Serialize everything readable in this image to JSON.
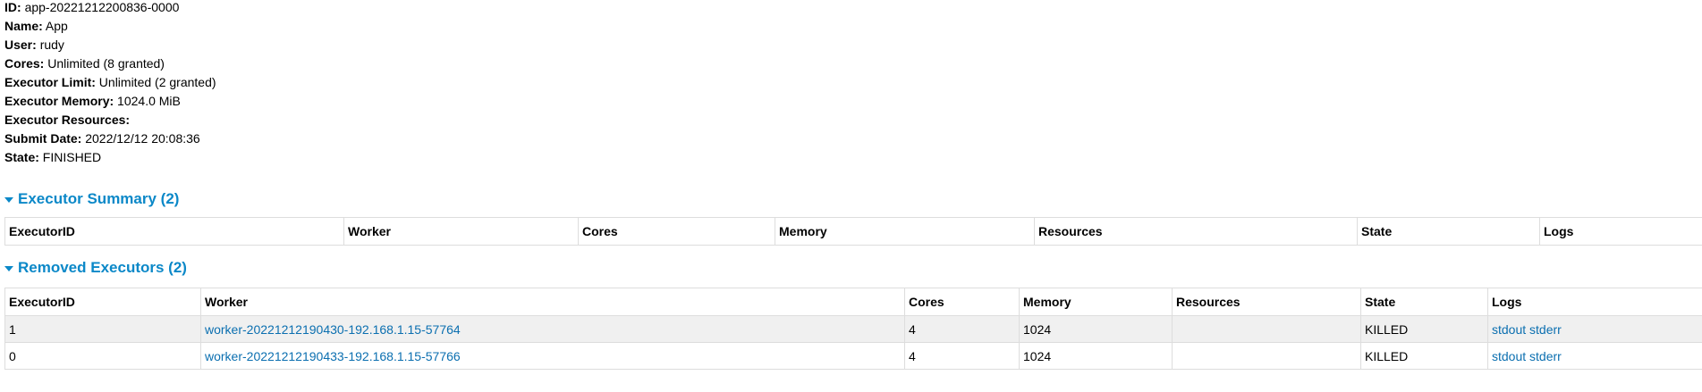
{
  "app_info": {
    "id_label": "ID:",
    "id_value": "app-20221212200836-0000",
    "name_label": "Name:",
    "name_value": "App",
    "user_label": "User:",
    "user_value": "rudy",
    "cores_label": "Cores:",
    "cores_value": "Unlimited (8 granted)",
    "exec_limit_label": "Executor Limit:",
    "exec_limit_value": "Unlimited (2 granted)",
    "exec_memory_label": "Executor Memory:",
    "exec_memory_value": "1024.0 MiB",
    "exec_resources_label": "Executor Resources:",
    "exec_resources_value": "",
    "submit_date_label": "Submit Date:",
    "submit_date_value": "2022/12/12 20:08:36",
    "state_label": "State:",
    "state_value": "FINISHED"
  },
  "executor_summary": {
    "title": "Executor Summary (2)",
    "headers": [
      "ExecutorID",
      "Worker",
      "Cores",
      "Memory",
      "Resources",
      "State",
      "Logs"
    ]
  },
  "removed_executors": {
    "title": "Removed Executors (2)",
    "headers": [
      "ExecutorID",
      "Worker",
      "Cores",
      "Memory",
      "Resources",
      "State",
      "Logs"
    ],
    "rows": [
      {
        "id": "1",
        "worker": "worker-20221212190430-192.168.1.15-57764",
        "cores": "4",
        "memory": "1024",
        "resources": "",
        "state": "KILLED",
        "stdout": "stdout",
        "stderr": "stderr"
      },
      {
        "id": "0",
        "worker": "worker-20221212190433-192.168.1.15-57766",
        "cores": "4",
        "memory": "1024",
        "resources": "",
        "state": "KILLED",
        "stdout": "stdout",
        "stderr": "stderr"
      }
    ]
  },
  "colors": {
    "link": "#0b6fb0",
    "section_title": "#0b88c8",
    "stripe": "#f0f0f0",
    "border": "#dddddd"
  }
}
